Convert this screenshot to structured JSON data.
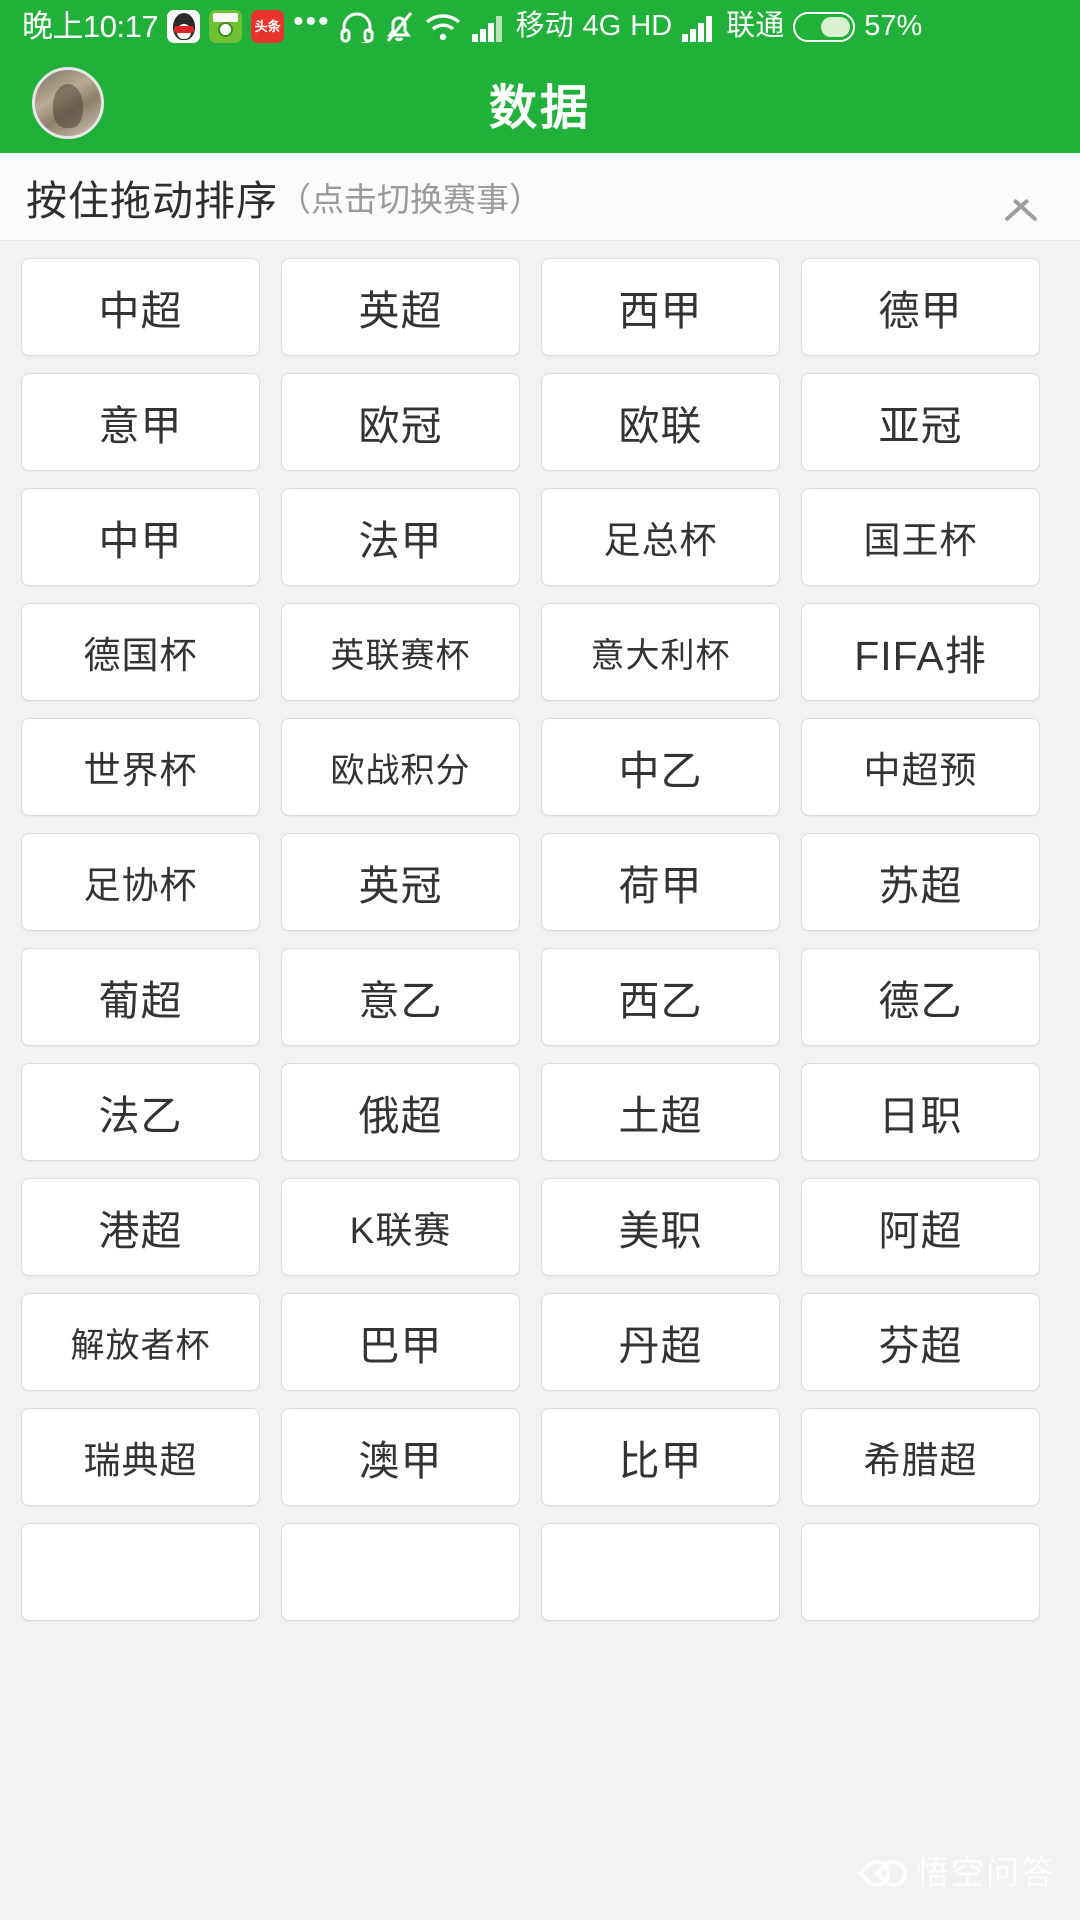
{
  "status_bar": {
    "time": "晚上10:17",
    "app_icons": [
      {
        "name": "qq-icon",
        "label": "QQ"
      },
      {
        "name": "football-app-icon",
        "label": "球"
      },
      {
        "name": "toutiao-icon",
        "label": "头条"
      }
    ],
    "overflow": "...",
    "icons": [
      "headset-icon",
      "bell-muted-icon",
      "wifi-icon",
      "signal-bars-icon"
    ],
    "carrier_primary": "移动",
    "network_type": "4G",
    "hd_label": "HD",
    "carrier_secondary": "联通",
    "battery_percent": "57%",
    "battery_level": 57
  },
  "header": {
    "title": "数据",
    "avatar_name": "user-avatar",
    "background_color": "#21b03a"
  },
  "sort_header": {
    "main_text": "按住拖动排序",
    "sub_text": "（点击切换赛事）",
    "collapse_icon": "chevron-up-icon"
  },
  "leagues": [
    "中超",
    "英超",
    "西甲",
    "德甲",
    "意甲",
    "欧冠",
    "欧联",
    "亚冠",
    "中甲",
    "法甲",
    "足总杯",
    "国王杯",
    "德国杯",
    "英联赛杯",
    "意大利杯",
    "FIFA排",
    "世界杯",
    "欧战积分",
    "中乙",
    "中超预",
    "足协杯",
    "英冠",
    "荷甲",
    "苏超",
    "葡超",
    "意乙",
    "西乙",
    "德乙",
    "法乙",
    "俄超",
    "土超",
    "日职",
    "港超",
    "K联赛",
    "美职",
    "阿超",
    "解放者杯",
    "巴甲",
    "丹超",
    "芬超",
    "瑞典超",
    "澳甲",
    "比甲",
    "希腊超",
    "",
    "",
    "",
    ""
  ],
  "watermark": {
    "text": "悟空问答"
  },
  "colors": {
    "brand_green": "#21b03a",
    "page_bg": "#f2f2f2",
    "chip_bg": "#ffffff",
    "chip_border": "#dcdcdc",
    "text_primary": "#333333",
    "text_muted": "#9a9a9a"
  }
}
